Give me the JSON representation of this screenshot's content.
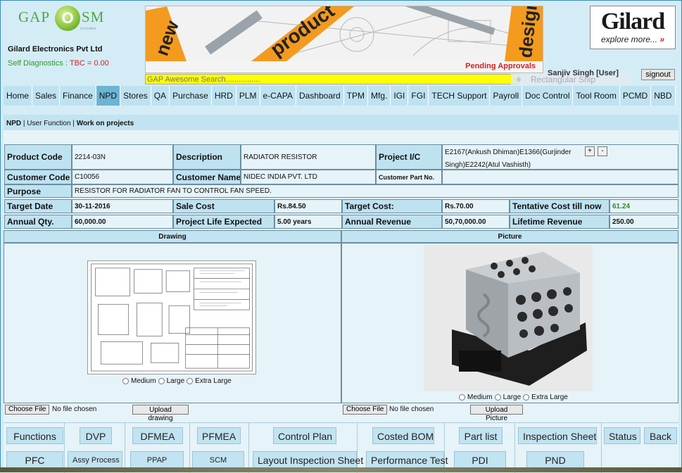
{
  "header": {
    "logo_left": "GAP",
    "logo_o": "O",
    "logo_right": "SM",
    "logo_tagline": "Innovative",
    "company": "Gilard Electronics Pvt Ltd",
    "diag_label": "Self Diagnostics : ",
    "diag_value": "TBC = 0.00",
    "banner_words": [
      "new",
      "product",
      "design"
    ],
    "pending": "Pending Approvals",
    "brand_name": "Gilard",
    "brand_tagline": "explore more...",
    "search_placeholder": "GAP Awesome Search................",
    "snip_overlay": "Rectangular Snip",
    "user": "Sanjiv Singh [User]",
    "signout": "signout"
  },
  "nav": [
    "Home",
    "Sales",
    "Finance",
    "NPD",
    "Stores",
    "QA",
    "Purchase",
    "HRD",
    "PLM",
    "e-CAPA",
    "Dashboard",
    "TPM",
    "Mfg.",
    "IGI",
    "FGI",
    "TECH Support",
    "Payroll",
    "Doc Control",
    "Tool Room",
    "PCMD",
    "NBD"
  ],
  "nav_active": "NPD",
  "breadcrumb": {
    "a": "NPD",
    "sep1": " | ",
    "b": "User Function",
    "sep2": " | ",
    "c": "Work on projects"
  },
  "form": {
    "product_code_label": "Product Code",
    "product_code": "2214-03N",
    "description_label": "Description",
    "description": "RADIATOR RESISTOR",
    "project_ic_label": "Project I/C",
    "project_ic": "E2167(Ankush Dhiman)E1366(Gurjinder Singh)E2242(Atul Vashisth)",
    "plus": "+",
    "minus": "-",
    "customer_code_label": "Customer Code",
    "customer_code": "C10056",
    "customer_name_label": "Customer Name",
    "customer_name": "NIDEC INDIA PVT. LTD",
    "customer_part_label": "Customer Part No.",
    "customer_part": "",
    "purpose_label": "Purpose",
    "purpose": "RESISTOR FOR RADIATOR FAN TO CONTROL FAN SPEED.",
    "target_date_label": "Target Date",
    "target_date": "30-11-2016",
    "sale_cost_label": "Sale Cost",
    "sale_cost": "Rs.84.50",
    "target_cost_label": "Target Cost:",
    "target_cost": "Rs.70.00",
    "tentative_label": "Tentative Cost till now",
    "tentative": "61.24",
    "annual_qty_label": "Annual Qty.",
    "annual_qty": "60,000.00",
    "life_label": "Project Life Expected",
    "life": "5.00 years",
    "annual_rev_label": "Annual Revenue",
    "annual_rev": "50,70,000.00",
    "lifetime_label": "Lifetime Revenue",
    "lifetime": "250.00"
  },
  "drawing": {
    "title": "Drawing",
    "sizes": [
      "Medium",
      "Large",
      "Extra Large"
    ],
    "choose": "Choose File",
    "nofile": "No file chosen",
    "upload": "Upload drawing"
  },
  "picture": {
    "title": "Picture",
    "sizes": [
      "Medium",
      "Large",
      "Extra Large"
    ],
    "choose": "Choose File",
    "nofile": "No file chosen",
    "upload": "Upload Picture"
  },
  "actions_row1": [
    "Functions",
    "DVP",
    "DFMEA",
    "PFMEA",
    "Control Plan",
    "Costed BOM",
    "Part list",
    "Inspection Sheet",
    "Status",
    "Back"
  ],
  "actions_row2": [
    "PFC",
    "Assy Process",
    "PPAP",
    "SCM",
    "Layout Inspection Sheet",
    "Performance Test",
    "PDI",
    "PND"
  ]
}
